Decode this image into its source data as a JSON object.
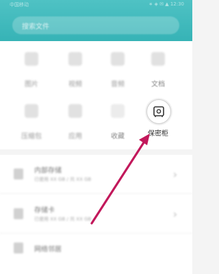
{
  "status": {
    "left": "中国移动",
    "right": "∗ ◈ ✉ ▲ 12:30"
  },
  "search": {
    "placeholder": "搜索文件"
  },
  "categories": [
    {
      "label": "图片",
      "icon": "image-icon"
    },
    {
      "label": "视频",
      "icon": "video-icon"
    },
    {
      "label": "音频",
      "icon": "music-icon"
    },
    {
      "label": "文档",
      "icon": "document-icon"
    },
    {
      "label": "压缩包",
      "icon": "archive-icon"
    },
    {
      "label": "应用",
      "icon": "apk-icon"
    },
    {
      "label": "收藏",
      "icon": "star-icon"
    },
    {
      "label": "保密柜",
      "icon": "safe-icon"
    }
  ],
  "storage": [
    {
      "title": "内部存储",
      "detail": "已使用 XX GB / 共 XX GB"
    },
    {
      "title": "存储卡",
      "detail": "已使用 XX GB / 共 XX GB"
    },
    {
      "title": "网络邻居",
      "detail": ""
    }
  ],
  "colors": {
    "header": "#3bb6b8",
    "arrow": "#c2185b"
  }
}
